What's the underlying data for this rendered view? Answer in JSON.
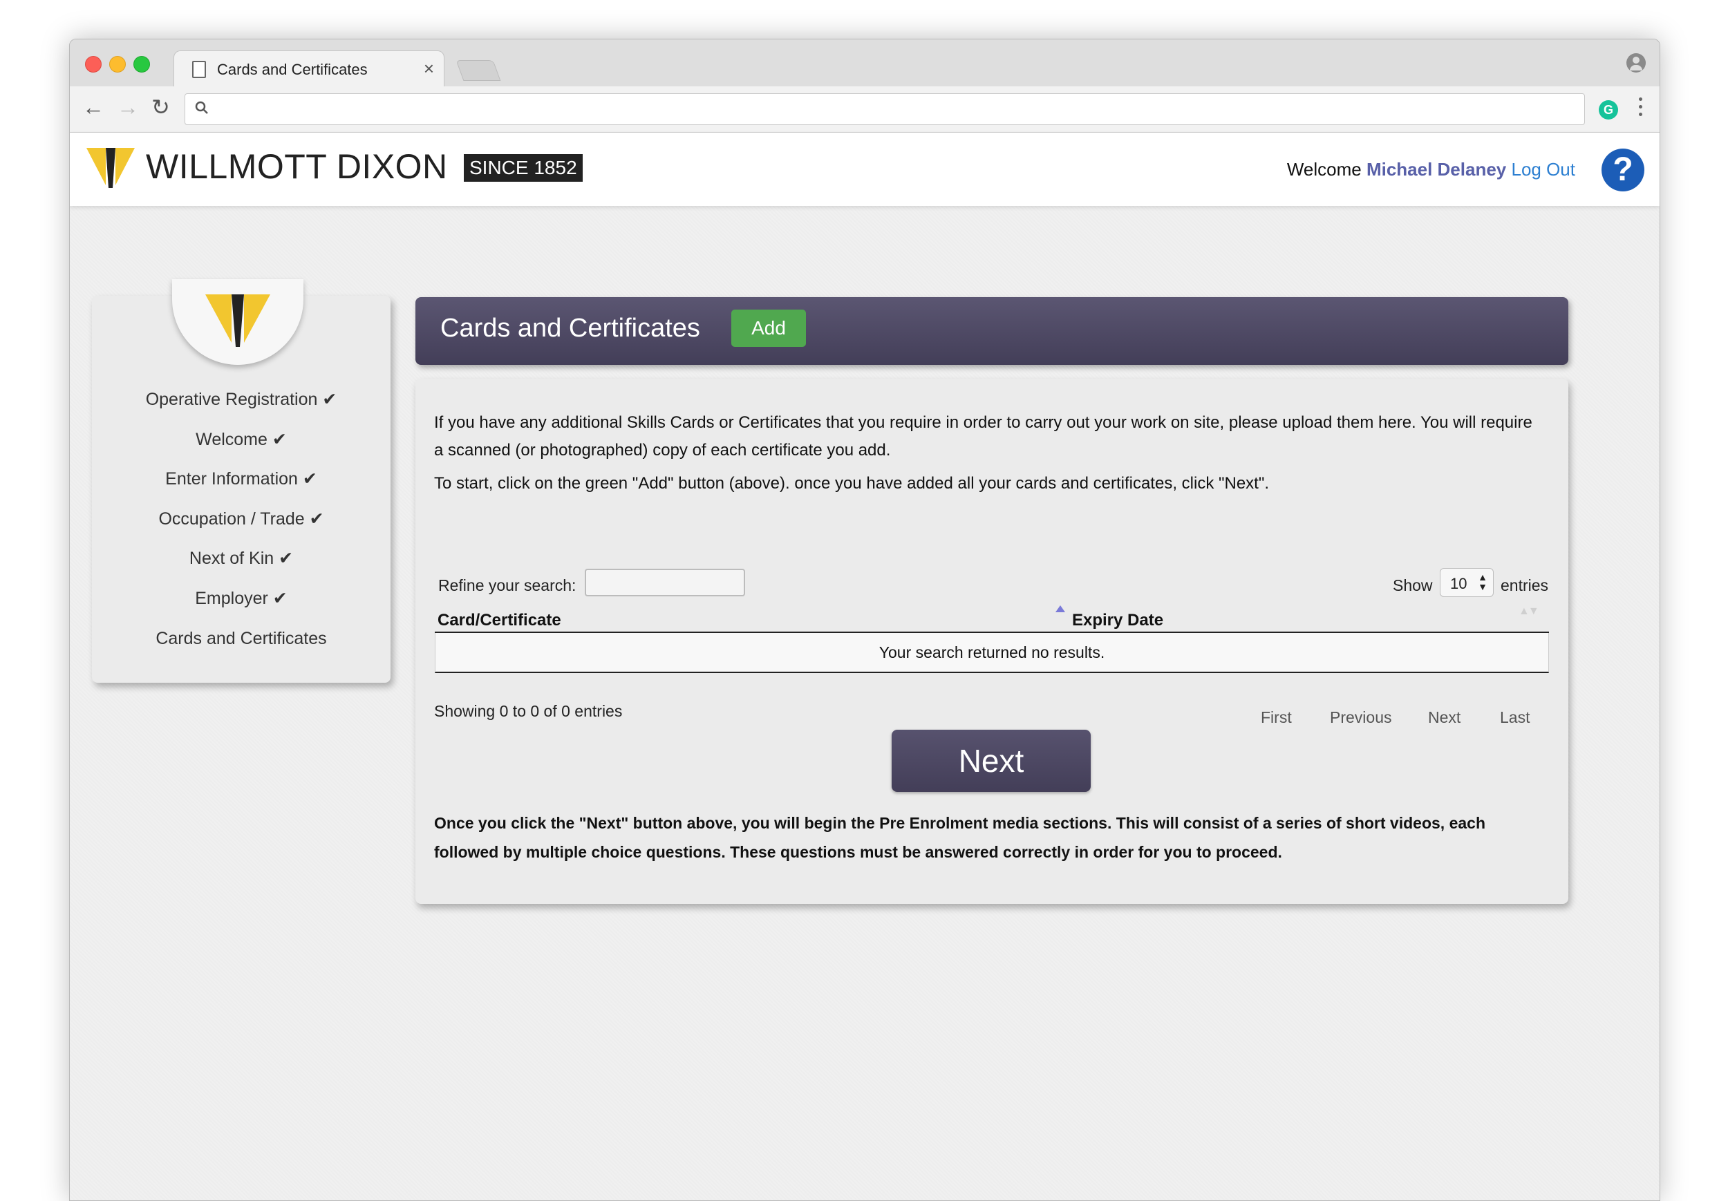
{
  "browser": {
    "tab_title": "Cards and Certificates",
    "tab_close": "×",
    "url": "",
    "grammarly": "G"
  },
  "header": {
    "logo_text": "WILLMOTT DIXON",
    "since_badge": "SINCE 1852",
    "welcome_label": "Welcome",
    "user_name": "Michael Delaney",
    "logout_label": "Log Out",
    "help_label": "?"
  },
  "sidebar": {
    "items": [
      {
        "label": "Operative Registration ✔"
      },
      {
        "label": "Welcome ✔"
      },
      {
        "label": "Enter Information ✔"
      },
      {
        "label": "Occupation / Trade ✔"
      },
      {
        "label": "Next of Kin ✔"
      },
      {
        "label": "Employer ✔"
      },
      {
        "label": "Cards and Certificates"
      }
    ]
  },
  "main": {
    "title": "Cards and Certificates",
    "add_label": "Add",
    "intro": "If you have any additional Skills Cards or Certificates that you require in order to carry out your work on site, please upload them here. You will require a scanned (or photographed) copy of each certificate you add.",
    "instruction": "To start, click on the green \"Add\" button (above). once you have added all your cards and certificates, click \"Next\".",
    "search_label": "Refine your search:",
    "search_value": "",
    "show_label": "Show",
    "entries_value": "10",
    "entries_label": "entries",
    "columns": [
      "Card/Certificate",
      "Expiry Date"
    ],
    "empty_message": "Your search returned no results.",
    "info": "Showing 0 to 0 of 0 entries",
    "pager": {
      "first": "First",
      "previous": "Previous",
      "next": "Next",
      "last": "Last"
    },
    "next_button": "Next",
    "footnote": "Once you click the \"Next\" button above, you will begin the Pre Enrolment media sections. This will consist of a series of short videos, each followed by multiple choice questions. These questions must be answered correctly in order for you to proceed."
  },
  "colors": {
    "header_purple": "#4e4965",
    "add_green": "#50a84f",
    "user_name": "#5860a8",
    "logout_link": "#2c7fd1",
    "help_blue": "#1c5db7",
    "logo_yellow": "#f2c62f"
  },
  "icons": [
    "document-icon",
    "close-icon",
    "back-arrow-icon",
    "forward-arrow-icon",
    "reload-icon",
    "search-icon",
    "grammarly-icon",
    "menu-dots-icon",
    "profile-icon",
    "help-icon",
    "sort-asc-icon",
    "sort-both-icon"
  ]
}
